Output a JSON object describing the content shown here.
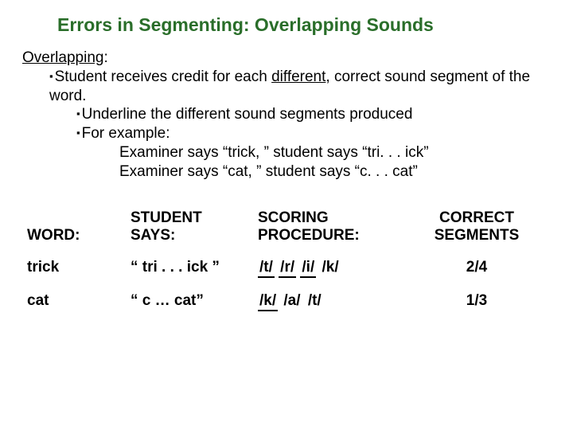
{
  "title": "Errors in Segmenting: Overlapping Sounds",
  "lead_label": "Overlapping",
  "lead_colon": ":",
  "bullets": {
    "l1_pre": "Student receives credit for each ",
    "l1_u": "different",
    "l1_post": ", correct sound segment of the word.",
    "l2a": "Underline the different sound segments produced",
    "l2b": "For example:",
    "ex1": "Examiner says “trick, ” student says “tri. . . ick”",
    "ex2": "Examiner says “cat, ” student says “c. . . cat”"
  },
  "headers": {
    "word": "WORD:",
    "says_l1": "STUDENT",
    "says_l2": "SAYS:",
    "proc_l1": "SCORING",
    "proc_l2": "PROCEDURE:",
    "corr_l1": "CORRECT",
    "corr_l2": "SEGMENTS"
  },
  "rows": [
    {
      "word": "trick",
      "says": "“ tri . . . ick ”",
      "proc": [
        {
          "t": "/t/",
          "u": true
        },
        {
          "t": "/r/",
          "u": true
        },
        {
          "t": "/i/",
          "u": true
        },
        {
          "t": "/k/",
          "u": false
        }
      ],
      "score": "2/4"
    },
    {
      "word": "cat",
      "says": "“ c … cat”",
      "proc": [
        {
          "t": "/k/",
          "u": true
        },
        {
          "t": "/a/",
          "u": false
        },
        {
          "t": "/t/",
          "u": false
        }
      ],
      "score": "1/3"
    }
  ]
}
